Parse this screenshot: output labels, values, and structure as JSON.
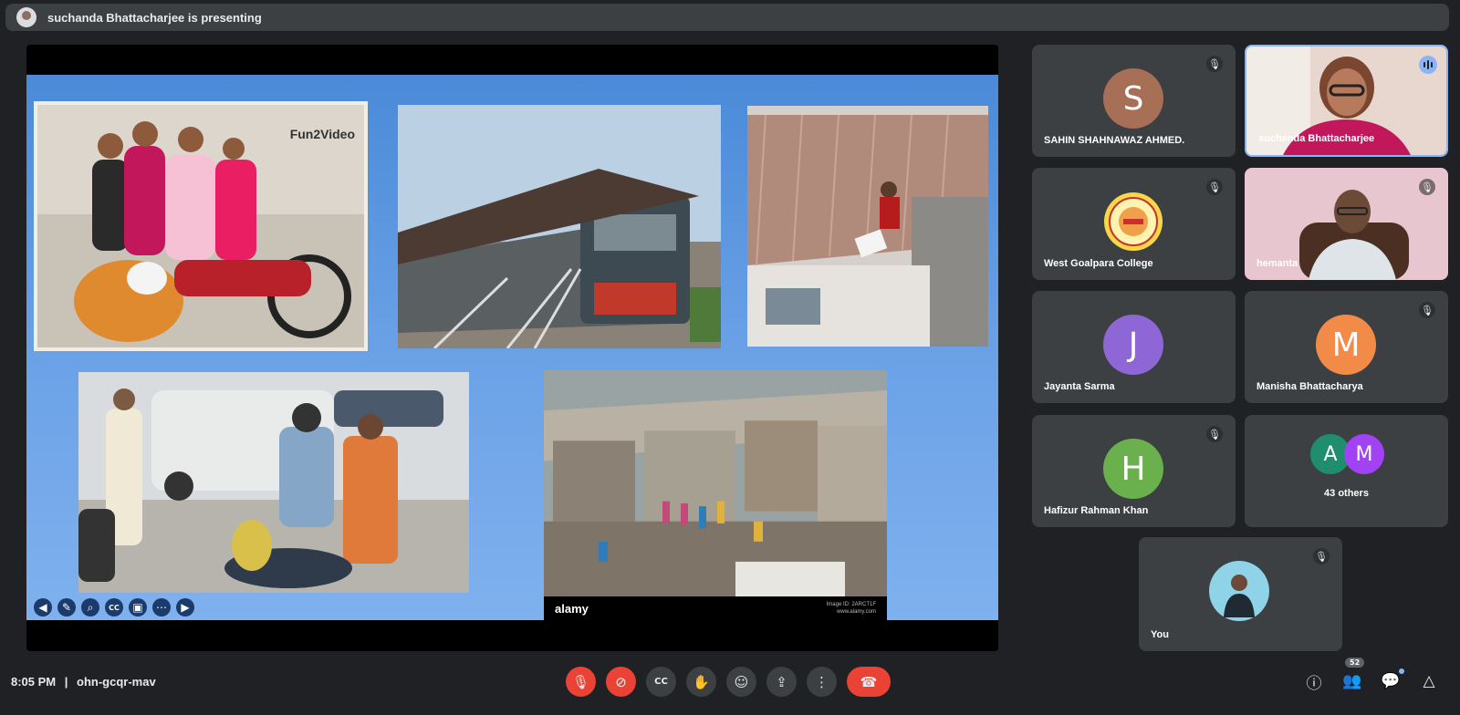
{
  "topbar": {
    "presenting_text": "suchanda Bhattacharjee is presenting"
  },
  "slide": {
    "watermark": "Fun2Video",
    "stock_logo": "alamy",
    "stock_id": "Image ID: 2ARCT1F",
    "stock_url": "www.alamy.com"
  },
  "slide_controls": [
    "previous-icon",
    "pen-icon",
    "zoom-icon",
    "captions-icon",
    "video-icon",
    "more-icon",
    "next-icon"
  ],
  "participants": {
    "sahin": {
      "initial": "S",
      "name": "SAHIN SHAHNAWAZ AHMED.",
      "color": "#a86f57"
    },
    "suchanda": {
      "name": "suchanda Bhattacharjee"
    },
    "west_goalpara": {
      "name": "West Goalpara College"
    },
    "hemanta": {
      "name": "hemanta"
    },
    "jayanta": {
      "initial": "J",
      "name": "Jayanta Sarma",
      "color": "#8e66d6"
    },
    "manisha": {
      "initial": "M",
      "name": "Manisha Bhattacharya",
      "color": "#f28b48"
    },
    "hafizur": {
      "initial": "H",
      "name": "Hafizur Rahman Khan",
      "color": "#6ab04c"
    },
    "others": {
      "initial_a": "A",
      "initial_m": "M",
      "label": "43 others",
      "color_a": "#1e8e6e",
      "color_m": "#a142f4"
    },
    "you": {
      "name": "You"
    }
  },
  "meeting": {
    "time": "8:05 PM",
    "separator": "|",
    "code": "ohn-gcqr-mav"
  },
  "participant_count": "52"
}
